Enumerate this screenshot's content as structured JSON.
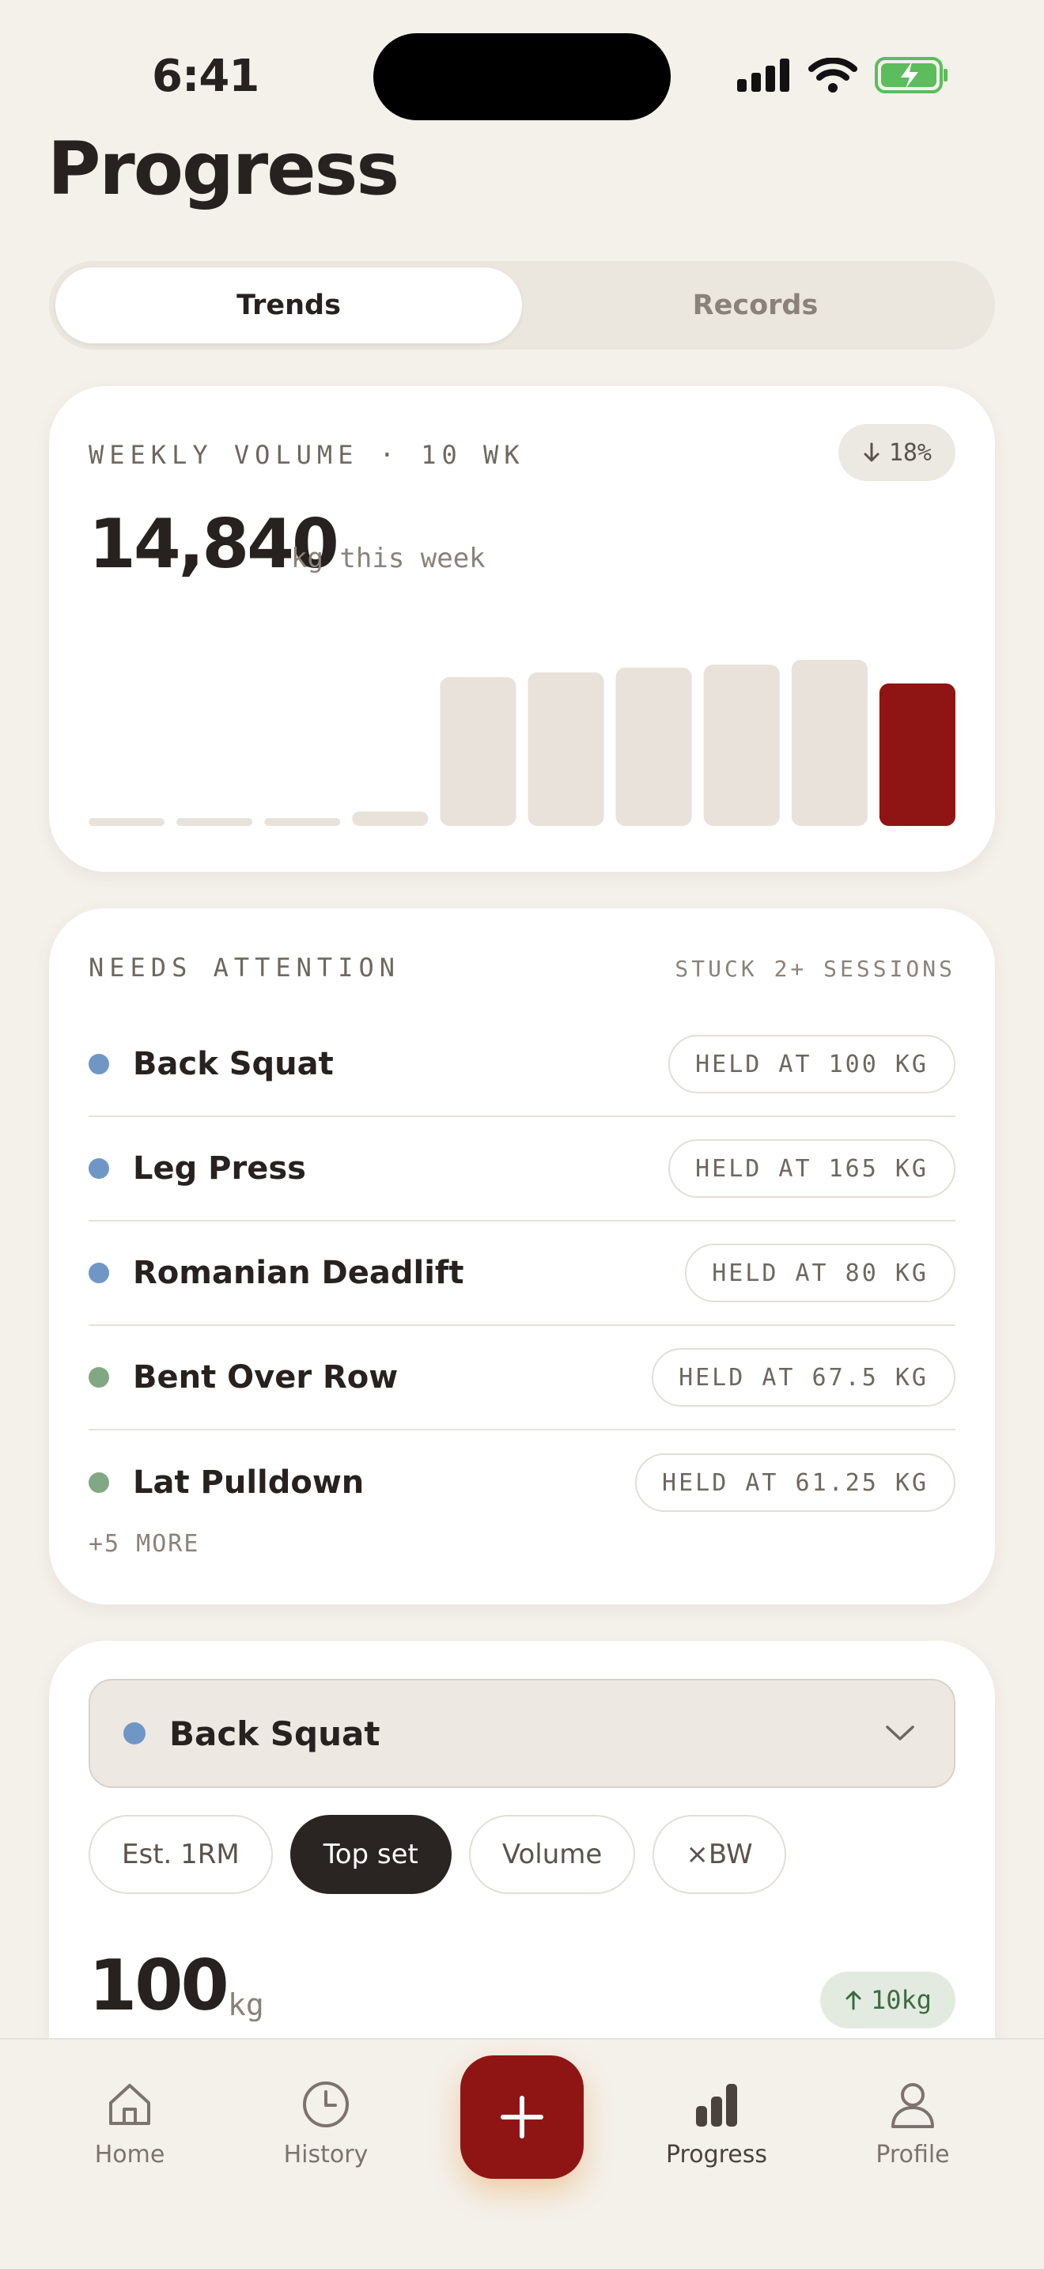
{
  "status": {
    "time": "6:41"
  },
  "page": {
    "title": "Progress"
  },
  "segments": [
    {
      "label": "Trends",
      "active": true
    },
    {
      "label": "Records",
      "active": false
    }
  ],
  "weekly_volume": {
    "eyebrow": "WEEKLY VOLUME · 10 WK",
    "trend": "18%",
    "trend_direction": "down",
    "value": "14,840",
    "unit": "kg this week",
    "accent_color": "#8f1515",
    "bar_color": "#e8e2da",
    "chart_data": {
      "type": "bar",
      "values": [
        0,
        0,
        0,
        1500,
        15500,
        16000,
        16500,
        16800,
        17300,
        14840
      ],
      "highlight_index": 9
    }
  },
  "attention": {
    "eyebrow": "NEEDS ATTENTION",
    "subtitle": "STUCK 2+ SESSIONS",
    "items": [
      {
        "name": "Back Squat",
        "status": "HELD AT 100 KG",
        "color": "blue"
      },
      {
        "name": "Leg Press",
        "status": "HELD AT 165 KG",
        "color": "blue"
      },
      {
        "name": "Romanian Deadlift",
        "status": "HELD AT 80 KG",
        "color": "blue"
      },
      {
        "name": "Bent Over Row",
        "status": "HELD AT 67.5 KG",
        "color": "green"
      },
      {
        "name": "Lat Pulldown",
        "status": "HELD AT 61.25 KG",
        "color": "green"
      }
    ],
    "more": "+5 MORE"
  },
  "exercise": {
    "selected": "Back Squat",
    "metrics": [
      {
        "label": "Est. 1RM",
        "active": false
      },
      {
        "label": "Top set",
        "active": true
      },
      {
        "label": "Volume",
        "active": false
      },
      {
        "label": "×BW",
        "active": false
      }
    ],
    "value": "100",
    "unit": "kg",
    "delta": "10kg",
    "delta_direction": "up"
  },
  "tabbar": {
    "items": [
      {
        "label": "Home",
        "icon": "home-icon"
      },
      {
        "label": "History",
        "icon": "clock-icon"
      },
      {
        "label": "Progress",
        "icon": "bar-chart-icon",
        "active": true
      },
      {
        "label": "Profile",
        "icon": "profile-icon"
      }
    ],
    "fab_icon": "plus-icon"
  }
}
